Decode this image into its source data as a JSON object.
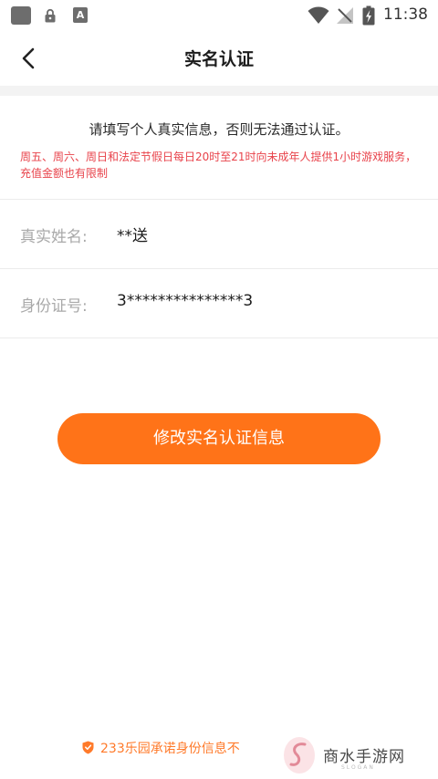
{
  "status_bar": {
    "time": "11:38",
    "keyboard_badge": "A",
    "icons": [
      "app-icon",
      "lock-icon",
      "keyboard-icon",
      "wifi-icon",
      "signal-icon",
      "battery-icon"
    ]
  },
  "header": {
    "title": "实名认证",
    "back_icon": "chevron-left-icon"
  },
  "notice": {
    "main": "请填写个人真实信息，否则无法通过认证。",
    "warning": "周五、周六、周日和法定节假日每日20时至21时向未成年人提供1小时游戏服务，充值金额也有限制"
  },
  "fields": {
    "name": {
      "label": "真实姓名:",
      "value": "**送"
    },
    "id_number": {
      "label": "身份证号:",
      "value": "3***************3"
    }
  },
  "actions": {
    "modify_label": "修改实名认证信息"
  },
  "footer": {
    "text": "233乐园承诺身份信息不",
    "icon": "shield-icon"
  },
  "watermark": {
    "text": "商水手游网",
    "slogan": "SLOGAN"
  },
  "colors": {
    "accent": "#ff7318",
    "warning": "#e8424a",
    "label": "#a9a9a9",
    "divider": "#ececec",
    "band": "#f3f3f3"
  }
}
